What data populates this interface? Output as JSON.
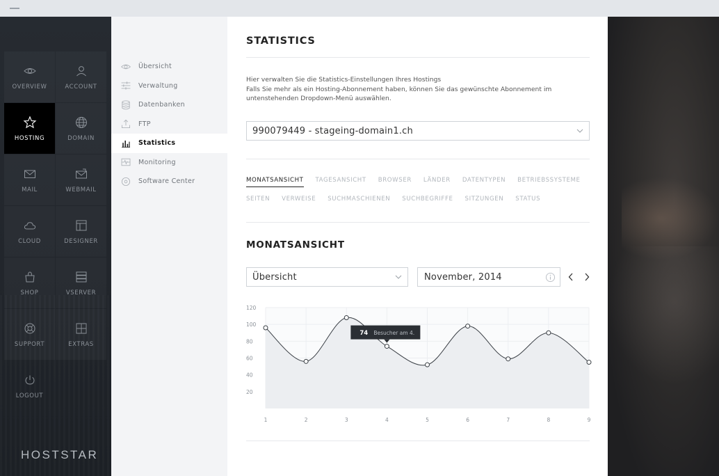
{
  "nav": {
    "items": [
      {
        "key": "overview",
        "label": "OVERVIEW",
        "icon": "eye-icon",
        "active": false
      },
      {
        "key": "account",
        "label": "ACCOUNT",
        "icon": "user-icon",
        "active": false
      },
      {
        "key": "hosting",
        "label": "HOSTING",
        "icon": "star-icon",
        "active": true
      },
      {
        "key": "domain",
        "label": "DOMAIN",
        "icon": "globe-icon",
        "active": false
      },
      {
        "key": "mail",
        "label": "MAIL",
        "icon": "envelope-icon",
        "active": false
      },
      {
        "key": "webmail",
        "label": "WEBMAIL",
        "icon": "webmail-icon",
        "active": false
      },
      {
        "key": "cloud",
        "label": "CLOUD",
        "icon": "cloud-icon",
        "active": false
      },
      {
        "key": "designer",
        "label": "DESIGNER",
        "icon": "layout-icon",
        "active": false
      },
      {
        "key": "shop",
        "label": "SHOP",
        "icon": "shopping-bag-icon",
        "active": false
      },
      {
        "key": "vserver",
        "label": "VSERVER",
        "icon": "server-icon",
        "active": false
      },
      {
        "key": "support",
        "label": "SUPPORT",
        "icon": "lifebuoy-icon",
        "active": false
      },
      {
        "key": "extras",
        "label": "EXTRAS",
        "icon": "extras-grid-icon",
        "active": false
      },
      {
        "key": "logout",
        "label": "LOGOUT",
        "icon": "power-icon",
        "active": false
      }
    ],
    "logo": "HOSTSTAR"
  },
  "submenu": {
    "items": [
      {
        "label": "Übersicht",
        "icon": "eye-icon",
        "active": false
      },
      {
        "label": "Verwaltung",
        "icon": "sliders-icon",
        "active": false
      },
      {
        "label": "Datenbanken",
        "icon": "database-icon",
        "active": false
      },
      {
        "label": "FTP",
        "icon": "upload-icon",
        "active": false
      },
      {
        "label": "Statistics",
        "icon": "bar-chart-icon",
        "active": true
      },
      {
        "label": "Monitoring",
        "icon": "pulse-icon",
        "active": false
      },
      {
        "label": "Software Center",
        "icon": "disc-icon",
        "active": false
      }
    ]
  },
  "content": {
    "title": "STATISTICS",
    "desc_line1": "Hier verwalten Sie die Statistics-Einstellungen Ihres Hostings",
    "desc_line2": "Falls Sie mehr als ein Hosting-Abonnement haben, können Sie das gewünschte Abonnement im untenstehenden Dropdown-Menü auswählen.",
    "subscription_select": "990079449 - stageing-domain1.ch",
    "tabs_row1": [
      {
        "label": "MONATSANSICHT",
        "active": true
      },
      {
        "label": "TAGESANSICHT",
        "active": false
      },
      {
        "label": "BROWSER",
        "active": false
      },
      {
        "label": "LÄNDER",
        "active": false
      },
      {
        "label": "DATENTYPEN",
        "active": false
      },
      {
        "label": "BETRIEBSSYSTEME",
        "active": false
      }
    ],
    "tabs_row2": [
      {
        "label": "SEITEN",
        "active": false
      },
      {
        "label": "VERWEISE",
        "active": false
      },
      {
        "label": "SUCHMASCHIENEN",
        "active": false
      },
      {
        "label": "SUCHBEGRIFFE",
        "active": false
      },
      {
        "label": "SITZUNGEN",
        "active": false
      },
      {
        "label": "STATUS",
        "active": false
      }
    ],
    "section_title": "MONATSANSICHT",
    "view_select": "Übersicht",
    "date_value": "November, 2014"
  },
  "colors": {
    "accent_dark": "#2b2f34",
    "chart_fill": "#eceef1",
    "chart_line": "#3a3f45",
    "active_nav": "#000000"
  },
  "chart_data": {
    "type": "area",
    "x": [
      1,
      2,
      3,
      4,
      5,
      6,
      7,
      8,
      9
    ],
    "x_tick_labels": [
      "1",
      "2",
      "3",
      "4",
      "5",
      "6",
      "7",
      "8",
      "9"
    ],
    "series": [
      {
        "values": [
          96,
          56,
          108,
          74,
          52,
          98,
          59,
          90,
          55
        ]
      }
    ],
    "y_tick_labels": [
      "20",
      "40",
      "60",
      "80",
      "100",
      "120"
    ],
    "ylim": [
      0,
      120
    ],
    "grid": true,
    "tooltip": {
      "value": "74",
      "text": "Besucher am 4.",
      "point_index": 3
    }
  }
}
